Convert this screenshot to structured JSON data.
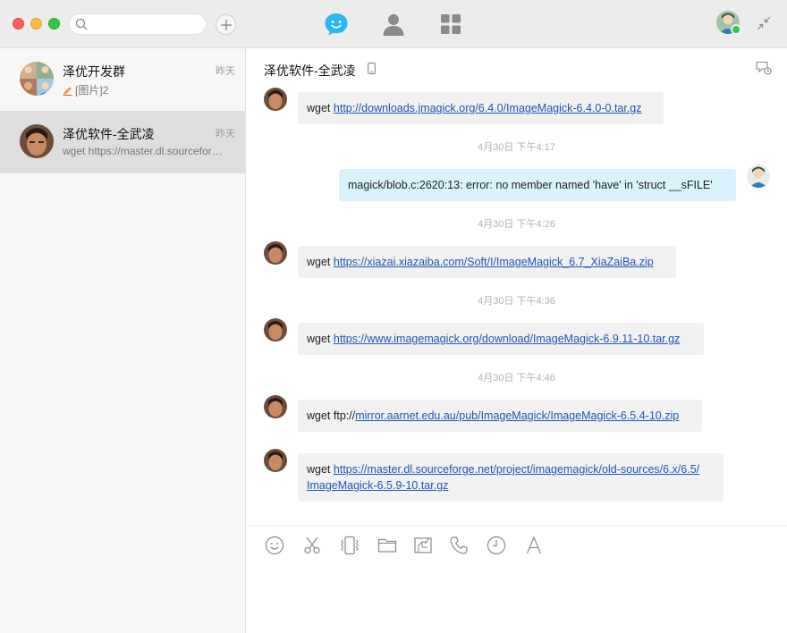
{
  "icons": {
    "search": "search-icon",
    "add": "plus-icon",
    "nav": [
      "chat-bubble-icon",
      "contacts-icon",
      "apps-grid-icon"
    ],
    "shrink": "shrink-arrows-icon",
    "toolbar": [
      "emoji-icon",
      "scissors-icon",
      "vibrate-icon",
      "folder-icon",
      "image-edit-icon",
      "phone-icon",
      "clock-icon",
      "font-icon"
    ]
  },
  "colors": {
    "accent": "#2bb7f4",
    "link": "#1d56b6",
    "sent_bubble": "#d9f3fd",
    "received_bubble": "#f1f1f1",
    "online": "#34c84a"
  },
  "sidebar": {
    "conversations": [
      {
        "name": "泽优开发群",
        "time": "昨天",
        "preview": "[图片]2",
        "active": false
      },
      {
        "name": "泽优软件-全武凌",
        "time": "昨天",
        "preview": "wget https://master.dl.sourceforge.net/project/imagemagick",
        "active": true
      }
    ]
  },
  "chat": {
    "title": "泽优软件-全武凌",
    "messages": [
      {
        "sender": "other",
        "prefix": "wget ",
        "link": "http://downloads.jmagick.org/6.4.0/ImageMagick-6.4.0-0.tar.gz"
      },
      {
        "stamp": "4月30日  下午4:17"
      },
      {
        "sender": "me",
        "text": "magick/blob.c:2620:13: error: no member named 'have' in 'struct __sFILE'"
      },
      {
        "stamp": "4月30日  下午4:26"
      },
      {
        "sender": "other",
        "prefix": "wget ",
        "link": "https://xiazai.xiazaiba.com/Soft/I/ImageMagick_6.7_XiaZaiBa.zip"
      },
      {
        "stamp": "4月30日  下午4:36"
      },
      {
        "sender": "other",
        "prefix": "wget ",
        "link": "https://www.imagemagick.org/download/ImageMagick-6.9.11-10.tar.gz"
      },
      {
        "stamp": "4月30日  下午4:46"
      },
      {
        "sender": "other",
        "prefix": "wget ftp://",
        "link": "mirror.aarnet.edu.au/pub/ImageMagick/ImageMagick-6.5.4-10.zip"
      },
      {
        "sender": "other",
        "prefix": "wget ",
        "link": "https://master.dl.sourceforge.net/project/imagemagick/old-sources/6.x/6.5/",
        "link2": "ImageMagick-6.5.9-10.tar.gz"
      }
    ]
  }
}
